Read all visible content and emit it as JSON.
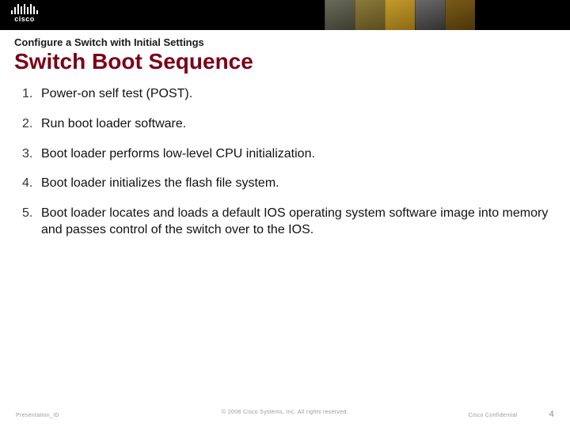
{
  "logo": {
    "text": "cisco"
  },
  "header": {
    "kicker": "Configure a Switch with Initial Settings",
    "title": "Switch Boot Sequence"
  },
  "steps": [
    "Power-on self test (POST).",
    "Run boot loader software.",
    "Boot loader performs low-level CPU initialization.",
    "Boot loader initializes the flash file system.",
    "Boot loader locates and loads a default IOS operating system software image into memory and passes control of the switch over to the IOS."
  ],
  "footer": {
    "left": "Presentation_ID",
    "mid": "© 2008 Cisco Systems, Inc. All rights reserved.",
    "conf": "Cisco Confidential",
    "page": "4"
  }
}
